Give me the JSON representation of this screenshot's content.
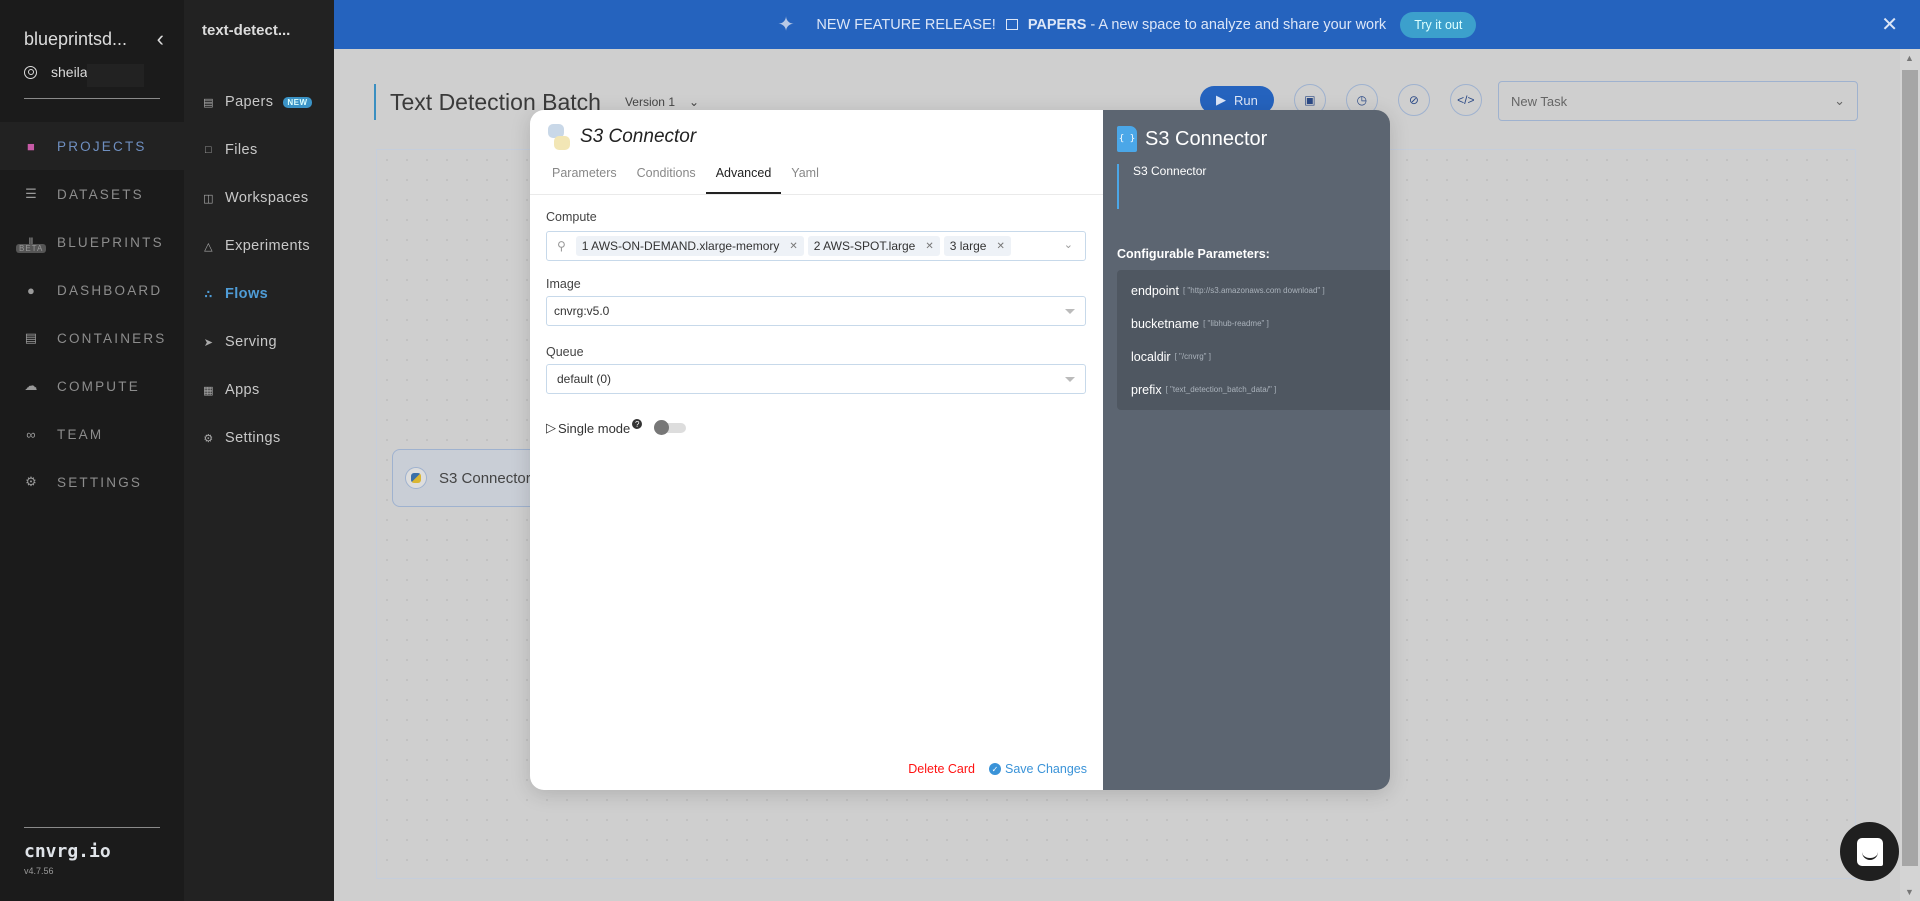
{
  "sidebar": {
    "org_name": "blueprintsd...",
    "user_name": "sheila",
    "items": [
      {
        "label": "PROJECTS",
        "icon": "projects-icon",
        "active": true
      },
      {
        "label": "DATASETS",
        "icon": "database-icon"
      },
      {
        "label": "BLUEPRINTS",
        "icon": "library-icon",
        "badge": "BETA"
      },
      {
        "label": "DASHBOARD",
        "icon": "gauge-icon"
      },
      {
        "label": "CONTAINERS",
        "icon": "containers-icon"
      },
      {
        "label": "COMPUTE",
        "icon": "cloud-icon"
      },
      {
        "label": "TEAM",
        "icon": "team-icon"
      },
      {
        "label": "SETTINGS",
        "icon": "gears-icon"
      }
    ],
    "brand": "cnvrg.io",
    "version": "v4.7.56"
  },
  "project_nav": {
    "project_name": "text-detect...",
    "items": [
      {
        "label": "Papers",
        "icon": "papers-icon",
        "badge": "NEW"
      },
      {
        "label": "Files",
        "icon": "file-icon"
      },
      {
        "label": "Workspaces",
        "icon": "workspace-icon"
      },
      {
        "label": "Experiments",
        "icon": "flask-icon"
      },
      {
        "label": "Flows",
        "icon": "flows-icon",
        "active": true
      },
      {
        "label": "Serving",
        "icon": "rocket-icon"
      },
      {
        "label": "Apps",
        "icon": "grid-icon"
      },
      {
        "label": "Settings",
        "icon": "gear-icon"
      }
    ]
  },
  "banner": {
    "headline": "NEW FEATURE RELEASE!",
    "feature": "PAPERS",
    "text": "- A new space to analyze and share your work",
    "cta": "Try it out"
  },
  "flow": {
    "title": "Text Detection Batch",
    "version": "Version 1",
    "run_label": "Run",
    "task_select": "New Task",
    "node_label": "S3 Connector"
  },
  "modal": {
    "title": "S3 Connector",
    "tabs": [
      "Parameters",
      "Conditions",
      "Advanced",
      "Yaml"
    ],
    "active_tab": "Advanced",
    "compute": {
      "label": "Compute",
      "selected": [
        "1 AWS-ON-DEMAND.xlarge-memory",
        "2 AWS-SPOT.large",
        "3 large"
      ]
    },
    "image": {
      "label": "Image",
      "value": "cnvrg:v5.0"
    },
    "queue": {
      "label": "Queue",
      "value": "default (0)"
    },
    "single_mode": {
      "label": "Single mode",
      "enabled": false
    },
    "delete_label": "Delete Card",
    "save_label": "Save Changes"
  },
  "info_panel": {
    "title": "S3 Connector",
    "description": "S3 Connector",
    "configurable_label": "Configurable Parameters:",
    "params": [
      {
        "name": "endpoint",
        "value": "[ \"http://s3.amazonaws.com download\" ]"
      },
      {
        "name": "bucketname",
        "value": "[ \"libhub-readme\" ]"
      },
      {
        "name": "localdir",
        "value": "[ \"/cnvrg\" ]"
      },
      {
        "name": "prefix",
        "value": "[ \"text_detection_batch_data/\" ]"
      }
    ]
  },
  "colors": {
    "accent": "#2563be",
    "active_nav": "#4f9cd6",
    "delete": "#ff1111",
    "save": "#3a93d8"
  }
}
